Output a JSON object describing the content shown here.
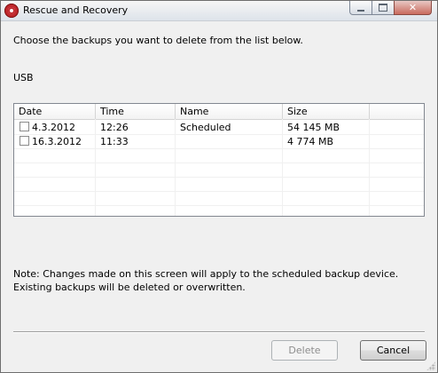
{
  "window": {
    "title": "Rescue and Recovery",
    "controls": {
      "minimize": "minimize",
      "maximize": "maximize",
      "close": "✕"
    }
  },
  "instruction": "Choose the backups you want to delete from the list below.",
  "device_label": "USB",
  "table": {
    "columns": [
      "Date",
      "Time",
      "Name",
      "Size"
    ],
    "rows": [
      {
        "checked": false,
        "date": "4.3.2012",
        "time": "12:26",
        "name": "Scheduled",
        "size": "54 145 MB"
      },
      {
        "checked": false,
        "date": "16.3.2012",
        "time": "11:33",
        "name": "",
        "size": "4 774 MB"
      }
    ]
  },
  "note": "Note:  Changes made on this screen will apply to the scheduled backup device. Existing backups will be deleted or overwritten.",
  "buttons": {
    "delete": "Delete",
    "cancel": "Cancel",
    "delete_enabled": false
  }
}
